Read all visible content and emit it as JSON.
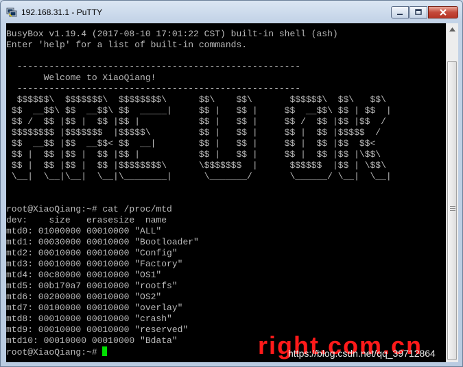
{
  "window": {
    "title": "192.168.31.1 - PuTTY",
    "app_icon": "putty-icon",
    "controls": [
      "minimize-icon",
      "maximize-icon",
      "close-icon"
    ]
  },
  "terminal": {
    "foreground": "#bbbbbb",
    "background": "#000000",
    "cursor_color": "#00e000",
    "lines": [
      "BusyBox v1.19.4 (2017-08-10 17:01:22 CST) built-in shell (ash)",
      "Enter 'help' for a list of built-in commands.",
      "",
      "  -----------------------------------------------------",
      "       Welcome to XiaoQiang!",
      "  -----------------------------------------------------",
      "  $$$$$$\\  $$$$$$$\\  $$$$$$$$\\      $$\\    $$\\       $$$$$$\\  $$\\   $$\\",
      " $$  __$$\\ $$  __$$\\ $$  _____|     $$ |   $$ |     $$  __$$\\ $$ | $$  |",
      " $$ /  $$ |$$ |  $$ |$$ |           $$ |   $$ |     $$ /  $$ |$$ |$$  /",
      " $$$$$$$$ |$$$$$$$  |$$$$$\\         $$ |   $$ |     $$ |  $$ |$$$$$  /",
      " $$  __$$ |$$  __$$< $$  __|        $$ |   $$ |     $$ |  $$ |$$  $$<",
      " $$ |  $$ |$$ |  $$ |$$ |           $$ |   $$ |     $$ |  $$ |$$ |\\$$\\",
      " $$ |  $$ |$$ |  $$ |$$$$$$$$\\      \\$$$$$$$  |      $$$$$$  |$$ | \\$$\\",
      " \\__|  \\__|\\__|  \\__|\\________|      \\_______/       \\______/ \\__|  \\__|",
      "",
      "",
      "root@XiaoQiang:~# cat /proc/mtd",
      "dev:    size   erasesize  name",
      "mtd0: 01000000 00010000 \"ALL\"",
      "mtd1: 00030000 00010000 \"Bootloader\"",
      "mtd2: 00010000 00010000 \"Config\"",
      "mtd3: 00010000 00010000 \"Factory\"",
      "mtd4: 00c80000 00010000 \"OS1\"",
      "mtd5: 00b170a7 00010000 \"rootfs\"",
      "mtd6: 00200000 00010000 \"OS2\"",
      "mtd7: 00100000 00010000 \"overlay\"",
      "mtd8: 00010000 00010000 \"crash\"",
      "mtd9: 00010000 00010000 \"reserved\"",
      "mtd10: 00010000 00010000 \"Bdata\"",
      "root@XiaoQiang:~# "
    ]
  },
  "watermark": {
    "logo_text": "right.com.cn",
    "url_text": "https://blog.csdn.net/qq_39712864",
    "color": "#ff1a1a"
  }
}
